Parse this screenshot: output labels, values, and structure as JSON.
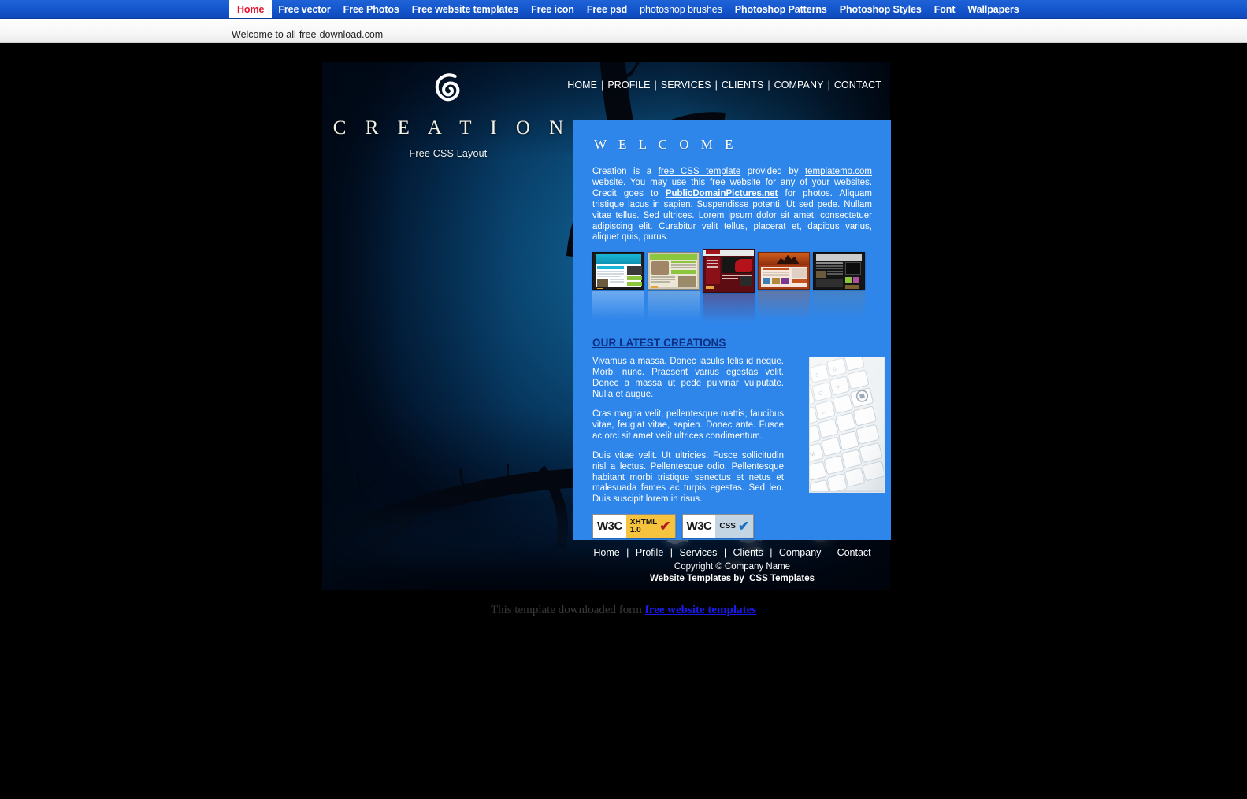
{
  "browser_bar": {
    "items": [
      {
        "label": "Home",
        "active": true
      },
      {
        "label": "Free vector",
        "active": false
      },
      {
        "label": "Free Photos",
        "active": false
      },
      {
        "label": "Free website templates",
        "active": false
      },
      {
        "label": "Free icon",
        "active": false
      },
      {
        "label": "Free psd",
        "active": false
      },
      {
        "label": "photoshop brushes",
        "active": false
      },
      {
        "label": "Photoshop Patterns",
        "active": false
      },
      {
        "label": "Photoshop Styles",
        "active": false
      },
      {
        "label": "Font",
        "active": false
      },
      {
        "label": "Wallpapers",
        "active": false
      }
    ],
    "welcome": "Welcome to all-free-download.com",
    "active_bg": "#ffffff",
    "active_fg": "#e8112d",
    "bar_bg": "#1558cf"
  },
  "brand": {
    "title": "C R E A T I O N",
    "subtitle": "Free CSS Layout",
    "logo_icon": "spiral-logo-icon"
  },
  "topnav": {
    "items": [
      "HOME",
      "PROFILE",
      "SERVICES",
      "CLIENTS",
      "COMPANY",
      "CONTACT"
    ],
    "separator": "|"
  },
  "panel": {
    "title": "W E L C O M E",
    "bg_color": "#2f86ea",
    "intro": {
      "part1": "Creation is a ",
      "link1": "free CSS template",
      "part2": " provided by ",
      "link2": "templatemo.com",
      "part3": " website. You may use this free website for any of your websites. Credit goes to ",
      "link3": "PublicDomainPictures.net",
      "part4": " for photos. Aliquam tristique lacus in sapien. Suspendisse potenti. Ut sed pede. Nullam vitae tellus. Sed ultrices. Lorem ipsum dolor sit amet, consectetuer adipiscing elit. Curabitur velit tellus, placerat et, dapibus varius, aliquet quis, purus."
    },
    "thumbnails": [
      {
        "name": "template-thumb-1",
        "accent": "#19b6d8",
        "body": "#f2f6f8",
        "frame": "#1b1b1b"
      },
      {
        "name": "template-thumb-2",
        "accent": "#8cc63f",
        "body": "#e8e2d2",
        "frame": "#cfc8b4"
      },
      {
        "name": "template-thumb-3",
        "accent": "#8b1118",
        "body": "#6e1117",
        "frame": "#5d0d12"
      },
      {
        "name": "template-thumb-4",
        "accent": "#c3521e",
        "body": "#f4e6dc",
        "frame": "#a83c14"
      },
      {
        "name": "template-thumb-5",
        "accent": "#2b2b2b",
        "body": "#3a3a3a",
        "frame": "#151515"
      }
    ],
    "latest_heading": "OUR LATEST CREATIONS",
    "latest_paragraphs": [
      "Vivamus a massa. Donec iaculis felis id neque. Morbi nunc. Praesent varius egestas velit. Donec a massa ut pede pulvinar vulputate. Nulla et augue.",
      "Cras magna velit, pellentesque mattis, faucibus vitae, feugiat vitae, sapien. Donec ante. Fusce ac orci sit amet velit ultrices condimentum.",
      "Duis vitae velit. Ut ultricies. Fusce sollicitudin nisl a lectus. Pellentesque odio. Pellentesque habitant morbi tristique senectus et netus et malesuada fames ac turpis egestas. Sed leo. Duis suscipit lorem in risus."
    ],
    "side_image": "keyboard-photo",
    "badges": [
      {
        "name": "w3c-xhtml-badge",
        "logo": "W3C",
        "label_line1": "XHTML",
        "label_line2": "1.0",
        "check": "✔",
        "bg": "#f5c33d",
        "check_color": "#b01523"
      },
      {
        "name": "w3c-css-badge",
        "logo": "W3C",
        "label_line1": "CSS",
        "label_line2": "",
        "check": "✔",
        "bg": "#c3d4e2",
        "check_color": "#1a6fc4"
      }
    ]
  },
  "footer": {
    "nav": [
      "Home",
      "Profile",
      "Services",
      "Clients",
      "Company",
      "Contact"
    ],
    "separator": "|",
    "copyright": "Copyright © Company Name",
    "credit_prefix": "Website Templates by",
    "credit_link": "CSS Templates"
  },
  "downloaded_note": {
    "text": "This template downloaded form ",
    "link": "free website templates"
  }
}
